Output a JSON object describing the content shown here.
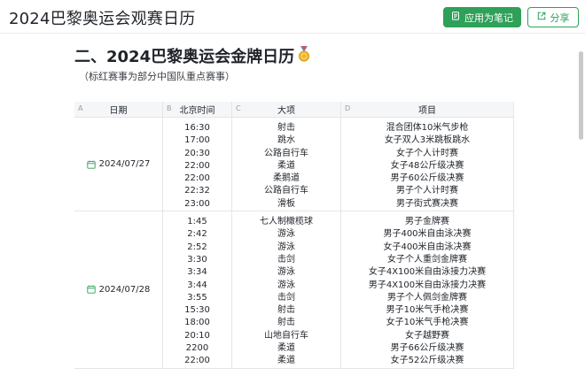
{
  "header": {
    "title": "2024巴黎奥运会观赛日历",
    "apply_label": "应用为笔记",
    "share_label": "分享",
    "accent": "#2ea058"
  },
  "doc": {
    "heading": "二、2024巴黎奥运会金牌日历",
    "subtitle": "（标红赛事为部分中国队重点赛事）"
  },
  "table": {
    "columns": [
      {
        "letter": "A",
        "label": "日期"
      },
      {
        "letter": "B",
        "label": "北京时间"
      },
      {
        "letter": "C",
        "label": "大项"
      },
      {
        "letter": "D",
        "label": "项目"
      }
    ],
    "groups": [
      {
        "date": "2024/07/27",
        "rows": [
          {
            "time": "16:30",
            "category": "射击",
            "event": "混合团体10米气步枪"
          },
          {
            "time": "17:00",
            "category": "跳水",
            "event": "女子双人3米跳板跳水"
          },
          {
            "time": "20:30",
            "category": "公路自行车",
            "event": "女子个人计时赛"
          },
          {
            "time": "22:00",
            "category": "柔道",
            "event": "女子48公斤级决赛"
          },
          {
            "time": "22:00",
            "category": "柔鹅道",
            "event": "男子60公斤级决赛"
          },
          {
            "time": "22:32",
            "category": "公路自行车",
            "event": "男子个人计时赛"
          },
          {
            "time": "23:00",
            "category": "滑板",
            "event": "男子街式赛决赛"
          }
        ]
      },
      {
        "date": "2024/07/28",
        "rows": [
          {
            "time": "1:45",
            "category": "七人制橄榄球",
            "event": "男子金牌赛"
          },
          {
            "time": "2:42",
            "category": "游泳",
            "event": "男子400米自由泳决赛"
          },
          {
            "time": "2:52",
            "category": "游泳",
            "event": "女子400米自由泳决赛"
          },
          {
            "time": "3:30",
            "category": "击剑",
            "event": "女子个人重剑金牌赛"
          },
          {
            "time": "3:34",
            "category": "游泳",
            "event": "女子4X100米自由泳接力决赛"
          },
          {
            "time": "3:44",
            "category": "游泳",
            "event": "男子4X100米自由泳接力决赛"
          },
          {
            "time": "3:55",
            "category": "击剑",
            "event": "男子个人佩剑金牌赛"
          },
          {
            "time": "15:30",
            "category": "射击",
            "event": "男子10米气手枪决赛"
          },
          {
            "time": "18:00",
            "category": "射击",
            "event": "女子10米气手枪决赛"
          },
          {
            "time": "20:10",
            "category": "山地自行车",
            "event": "女子越野赛"
          },
          {
            "time": "2200",
            "category": "柔道",
            "event": "男子66公斤级决赛"
          },
          {
            "time": "22:00",
            "category": "柔道",
            "event": "女子52公斤级决赛"
          }
        ]
      }
    ]
  }
}
